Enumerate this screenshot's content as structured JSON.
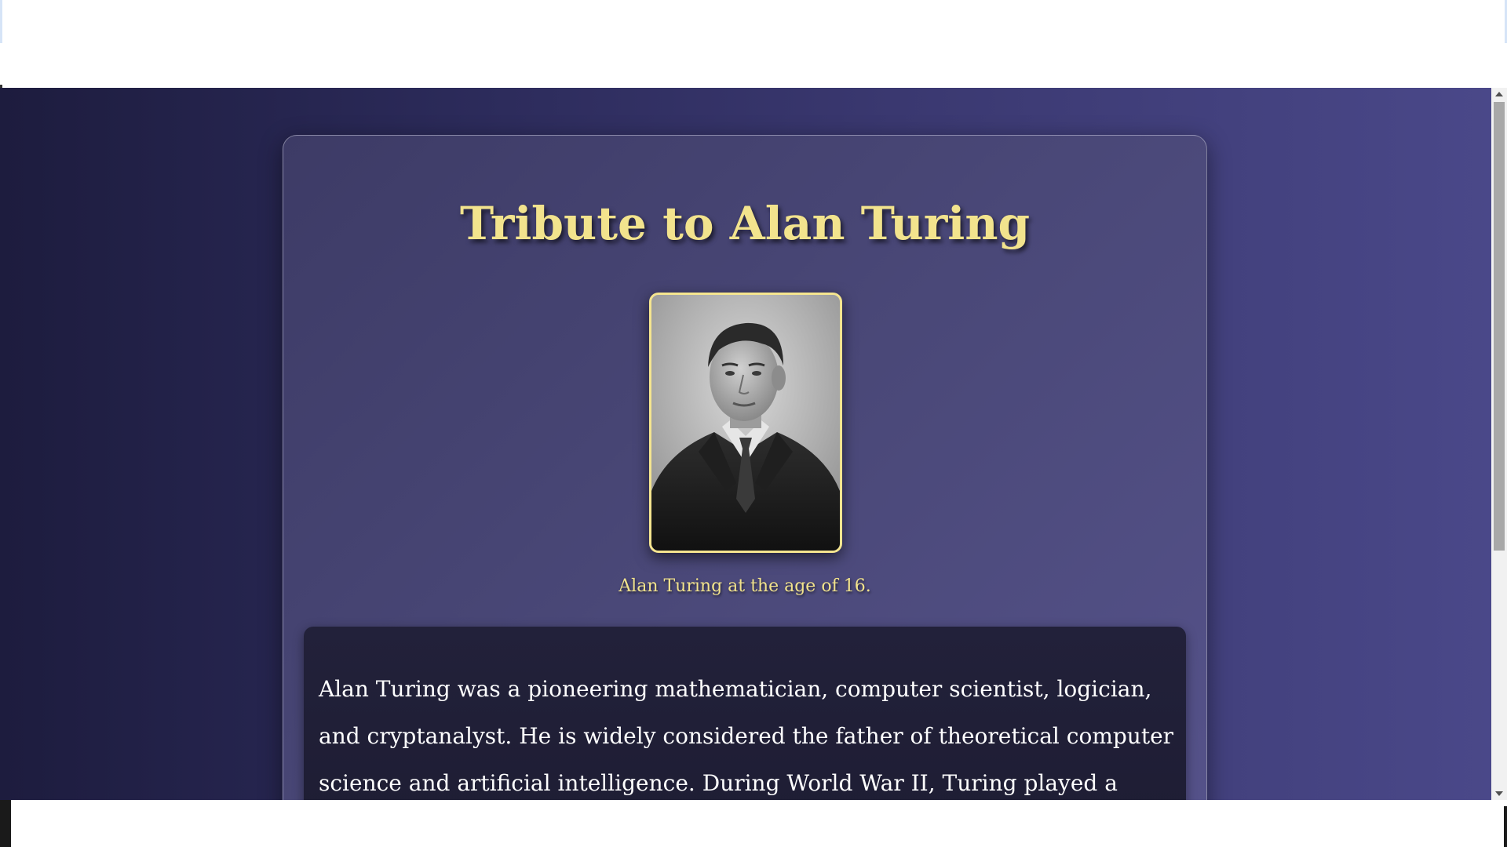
{
  "page": {
    "title": "Tribute to Alan Turing",
    "portrait_alt": "Alan Turing portrait",
    "caption": "Alan Turing at the age of 16.",
    "bio": "Alan Turing was a pioneering mathematician, computer scientist, logician, and cryptanalyst. He is widely considered the father of theoretical computer science and artificial intelligence. During World War II, Turing played a crucial role in"
  },
  "colors": {
    "accent": "#f2e38d",
    "background_start": "#1d1c3e",
    "background_end": "#4a4889",
    "card": "#4a4878",
    "bio_box": "#1d1c32",
    "text": "#ffffff"
  },
  "icons": {
    "scroll_up": "arrow-up-icon",
    "scroll_down": "arrow-down-icon"
  }
}
